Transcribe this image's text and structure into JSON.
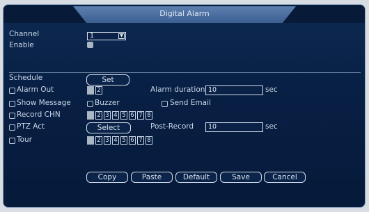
{
  "window": {
    "title": "Digital Alarm"
  },
  "channel": {
    "label": "Channel",
    "value": "1"
  },
  "enable": {
    "label": "Enable",
    "checked": true
  },
  "schedule": {
    "label": "Schedule",
    "button": "Set"
  },
  "alarm_out": {
    "label": "Alarm Out",
    "checked": false,
    "outputs": [
      "1",
      "2"
    ],
    "active": [
      "1"
    ]
  },
  "alarm_duration": {
    "label": "Alarm duration",
    "value": "10",
    "unit": "sec"
  },
  "show_message": {
    "label": "Show Message",
    "checked": false
  },
  "buzzer": {
    "label": "Buzzer",
    "checked": false
  },
  "send_email": {
    "label": "Send Email",
    "checked": false
  },
  "record_chn": {
    "label": "Record CHN",
    "checked": false,
    "channels": [
      "1",
      "2",
      "3",
      "4",
      "5",
      "6",
      "7",
      "8"
    ],
    "active": [
      "1"
    ]
  },
  "ptz_act": {
    "label": "PTZ Act",
    "checked": false,
    "button": "Select"
  },
  "post_record": {
    "label": "Post-Record",
    "value": "10",
    "unit": "sec"
  },
  "tour": {
    "label": "Tour",
    "checked": false,
    "channels": [
      "1",
      "2",
      "3",
      "4",
      "5",
      "6",
      "7",
      "8"
    ],
    "active": [
      "1"
    ]
  },
  "footer": {
    "copy": "Copy",
    "paste": "Paste",
    "default": "Default",
    "save": "Save",
    "cancel": "Cancel"
  },
  "colors": {
    "background": "#082045",
    "title_tab": "#4a6ea2",
    "text": "#c9d6e6"
  }
}
